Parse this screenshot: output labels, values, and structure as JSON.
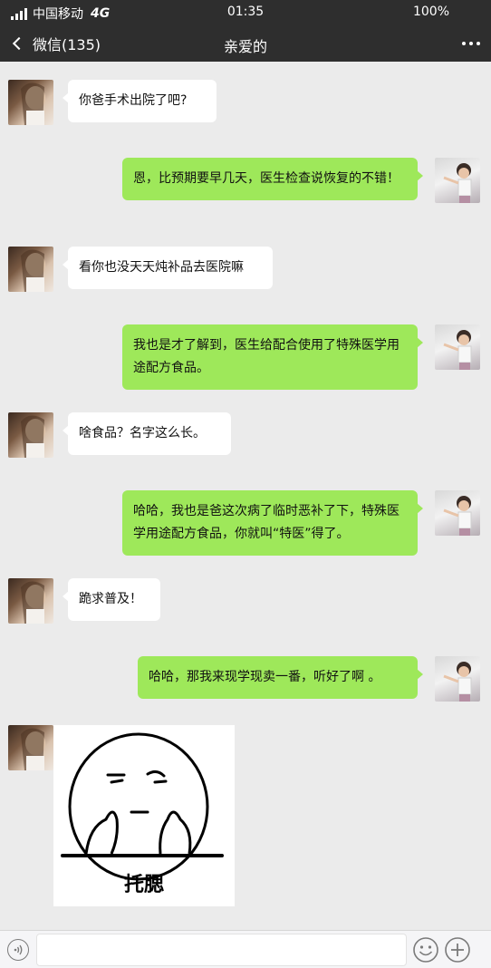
{
  "status_bar": {
    "carrier": "中国移动",
    "network": "4G",
    "time": "01:35",
    "battery": "100%"
  },
  "nav": {
    "back_label": "微信(135)",
    "title": "亲爱的"
  },
  "messages": [
    {
      "from": "them",
      "text": "你爸手术出院了吧?"
    },
    {
      "from": "me",
      "text": "恩，比预期要早几天，医生检查说恢复的不错！"
    },
    {
      "from": "them",
      "text": "看你也没天天炖补品去医院嘛"
    },
    {
      "from": "me",
      "text": "我也是才了解到，医生给配合使用了特殊医学用途配方食品。"
    },
    {
      "from": "them",
      "text": "啥食品？名字这么长。"
    },
    {
      "from": "me",
      "text": "哈哈，我也是爸这次病了临时恶补了下，特殊医学用途配方食品，你就叫“特医”得了。"
    },
    {
      "from": "them",
      "text": "跪求普及！"
    },
    {
      "from": "me",
      "text": "哈哈，那我来现学现卖一番，听好了啊 。"
    },
    {
      "from": "them",
      "sticker_text": "托腮"
    }
  ],
  "input": {
    "value": ""
  },
  "colors": {
    "header": "#2e2e2e",
    "background": "#ebebeb",
    "my_bubble": "#9ee85a",
    "their_bubble": "#ffffff"
  }
}
